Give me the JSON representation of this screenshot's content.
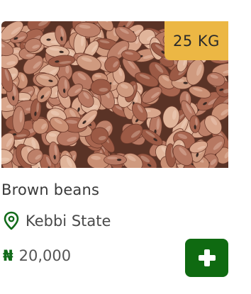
{
  "product": {
    "weight_badge": "25 KG",
    "title": "Brown beans",
    "location": "Kebbi State",
    "currency_symbol": "₦",
    "price": "20,000",
    "image_subject": "pile of brown beans"
  },
  "icons": {
    "location": "map-pin-icon",
    "add": "plus-icon"
  },
  "colors": {
    "badge_bg": "#ecb744",
    "accent_green": "#0f6a11",
    "currency_green": "#126b1a",
    "text_dark": "#3a3a3a"
  }
}
